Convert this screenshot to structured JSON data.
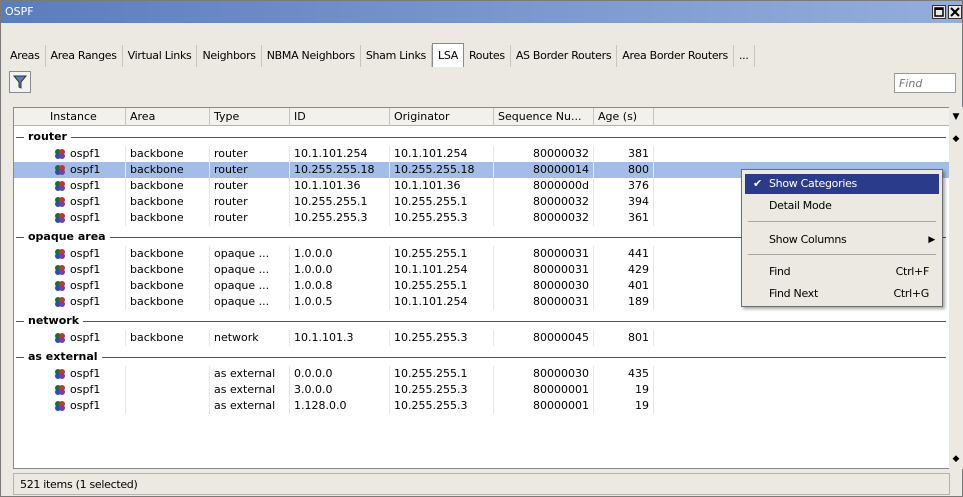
{
  "window": {
    "title": "OSPF"
  },
  "tabs": [
    {
      "label": "Areas",
      "active": false
    },
    {
      "label": "Area Ranges",
      "active": false
    },
    {
      "label": "Virtual Links",
      "active": false
    },
    {
      "label": "Neighbors",
      "active": false
    },
    {
      "label": "NBMA Neighbors",
      "active": false
    },
    {
      "label": "Sham Links",
      "active": false
    },
    {
      "label": "LSA",
      "active": true
    },
    {
      "label": "Routes",
      "active": false
    },
    {
      "label": "AS Border Routers",
      "active": false
    },
    {
      "label": "Area Border Routers",
      "active": false
    },
    {
      "label": "...",
      "active": false
    }
  ],
  "toolbar": {
    "filter_icon": "filter-icon",
    "find_placeholder": "Find"
  },
  "table": {
    "columns": [
      "Instance",
      "Area",
      "Type",
      "ID",
      "Originator",
      "Sequence Nu...",
      "Age (s)"
    ],
    "categories": [
      {
        "label": "router",
        "rows": [
          {
            "instance": "ospf1",
            "area": "backbone",
            "type": "router",
            "id": "10.1.101.254",
            "originator": "10.1.101.254",
            "seq": "80000032",
            "age": "381",
            "selected": false
          },
          {
            "instance": "ospf1",
            "area": "backbone",
            "type": "router",
            "id": "10.255.255.18",
            "originator": "10.255.255.18",
            "seq": "80000014",
            "age": "800",
            "selected": true
          },
          {
            "instance": "ospf1",
            "area": "backbone",
            "type": "router",
            "id": "10.1.101.36",
            "originator": "10.1.101.36",
            "seq": "8000000d",
            "age": "376",
            "selected": false
          },
          {
            "instance": "ospf1",
            "area": "backbone",
            "type": "router",
            "id": "10.255.255.1",
            "originator": "10.255.255.1",
            "seq": "80000032",
            "age": "394",
            "selected": false
          },
          {
            "instance": "ospf1",
            "area": "backbone",
            "type": "router",
            "id": "10.255.255.3",
            "originator": "10.255.255.3",
            "seq": "80000032",
            "age": "361",
            "selected": false
          }
        ]
      },
      {
        "label": "opaque area",
        "rows": [
          {
            "instance": "ospf1",
            "area": "backbone",
            "type": "opaque ...",
            "id": "1.0.0.0",
            "originator": "10.255.255.1",
            "seq": "80000031",
            "age": "441",
            "selected": false
          },
          {
            "instance": "ospf1",
            "area": "backbone",
            "type": "opaque ...",
            "id": "1.0.0.0",
            "originator": "10.1.101.254",
            "seq": "80000031",
            "age": "429",
            "selected": false
          },
          {
            "instance": "ospf1",
            "area": "backbone",
            "type": "opaque ...",
            "id": "1.0.0.8",
            "originator": "10.255.255.1",
            "seq": "80000030",
            "age": "401",
            "selected": false
          },
          {
            "instance": "ospf1",
            "area": "backbone",
            "type": "opaque ...",
            "id": "1.0.0.5",
            "originator": "10.1.101.254",
            "seq": "80000031",
            "age": "189",
            "selected": false
          }
        ]
      },
      {
        "label": "network",
        "rows": [
          {
            "instance": "ospf1",
            "area": "backbone",
            "type": "network",
            "id": "10.1.101.3",
            "originator": "10.255.255.3",
            "seq": "80000045",
            "age": "801",
            "selected": false
          }
        ]
      },
      {
        "label": "as external",
        "rows": [
          {
            "instance": "ospf1",
            "area": "",
            "type": "as external",
            "id": "0.0.0.0",
            "originator": "10.255.255.1",
            "seq": "80000030",
            "age": "435",
            "selected": false
          },
          {
            "instance": "ospf1",
            "area": "",
            "type": "as external",
            "id": "3.0.0.0",
            "originator": "10.255.255.3",
            "seq": "80000001",
            "age": "19",
            "selected": false
          },
          {
            "instance": "ospf1",
            "area": "",
            "type": "as external",
            "id": "1.128.0.0",
            "originator": "10.255.255.3",
            "seq": "80000001",
            "age": "19",
            "selected": false
          }
        ]
      }
    ]
  },
  "status": {
    "text": "521 items (1 selected)"
  },
  "context_menu": {
    "items": [
      {
        "label": "Show Categories",
        "checked": true,
        "shortcut": "",
        "submenu": false,
        "highlighted": true
      },
      {
        "label": "Detail Mode",
        "checked": false,
        "shortcut": "",
        "submenu": false,
        "highlighted": false
      },
      {
        "label": "Show Columns",
        "checked": false,
        "shortcut": "",
        "submenu": true,
        "highlighted": false
      },
      {
        "label": "Find",
        "checked": false,
        "shortcut": "Ctrl+F",
        "submenu": false,
        "highlighted": false
      },
      {
        "label": "Find Next",
        "checked": false,
        "shortcut": "Ctrl+G",
        "submenu": false,
        "highlighted": false
      }
    ]
  }
}
